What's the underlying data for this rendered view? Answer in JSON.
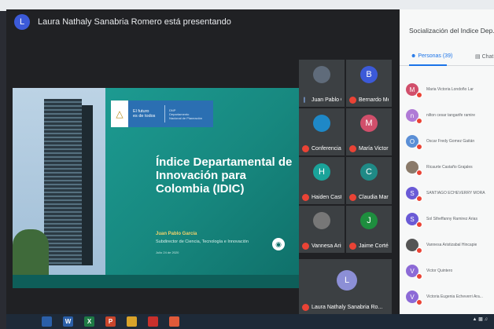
{
  "presenter": {
    "initial": "L",
    "text": "Laura Nathaly Sanabria Romero está presentando"
  },
  "slide": {
    "gov_line1": "El futuro",
    "gov_line2": "es de todos",
    "dnp_line1": "DNP",
    "dnp_line2": "Departamento",
    "dnp_line3": "Nacional de Planeación",
    "title": "Índice Departamental de Innovación para Colombia (IDIC)",
    "speaker": "Juan Pablo García",
    "role": "Subdirector de Ciencia, Tecnología e Innovación",
    "date": "Julio 24 de 2020"
  },
  "tiles": [
    {
      "name": "Juan Pablo G...",
      "initial": "",
      "color": "#5f6b7a",
      "mic_on": true
    },
    {
      "name": "Bernardo Mes...",
      "initial": "B",
      "color": "#3c5ad8",
      "mic_on": false
    },
    {
      "name": "Conferencias ...",
      "initial": "",
      "color": "#1e88c7",
      "mic_on": false
    },
    {
      "name": "María Victoria...",
      "initial": "M",
      "color": "#d14f6b",
      "mic_on": false
    },
    {
      "name": "Haiden Castill...",
      "initial": "H",
      "color": "#1aa39a",
      "mic_on": false
    },
    {
      "name": "Claudia Marc...",
      "initial": "C",
      "color": "#1f8a86",
      "mic_on": false
    },
    {
      "name": "Vannesa Arist...",
      "initial": "",
      "color": "#777777",
      "mic_on": false
    },
    {
      "name": "Jaime Cortés",
      "initial": "J",
      "color": "#1e8e3e",
      "mic_on": false
    }
  ],
  "big_tile": {
    "name": "Laura Nathaly Sanabria Ro...",
    "initial": "L",
    "color": "#8c8fd6"
  },
  "panel": {
    "title": "Socialización del Indice Dep...",
    "tab_people": "Personas (39)",
    "tab_chat": "Chat"
  },
  "people": [
    {
      "initial": "M",
      "color": "#d14f6b",
      "name": "Maria Victoria Londoño Lar"
    },
    {
      "initial": "n",
      "color": "#b07ad6",
      "name": "nilton cesar tangarife ramire"
    },
    {
      "initial": "O",
      "color": "#5b8fd6",
      "name": "Oscar Fredy Gomez Gaitán"
    },
    {
      "initial": "",
      "color": "#8a7a6a",
      "name": "Ricaurte Castaño Grajales"
    },
    {
      "initial": "S",
      "color": "#6a5ad6",
      "name": "SANTIAGO ECHEVERRY MORA"
    },
    {
      "initial": "S",
      "color": "#6a5ad6",
      "name": "Sol Stheffanny Ramirez Arias"
    },
    {
      "initial": "",
      "color": "#555555",
      "name": "Vannesa Aristizabal Hincapie"
    },
    {
      "initial": "V",
      "color": "#8c6ad6",
      "name": "Victor Quintero"
    },
    {
      "initial": "V",
      "color": "#8c6ad6",
      "name": "Victoria Eugenia Echeverri Ara..."
    }
  ],
  "taskbar": {
    "icons": [
      {
        "name": "start-icon",
        "label": "",
        "color": "#1e2a38"
      },
      {
        "name": "edge-icon",
        "label": "",
        "color": "#2b5fa8"
      },
      {
        "name": "word-icon",
        "label": "W",
        "color": "#2b5fa8"
      },
      {
        "name": "excel-icon",
        "label": "X",
        "color": "#1e7a45"
      },
      {
        "name": "powerpoint-icon",
        "label": "P",
        "color": "#c8452c"
      },
      {
        "name": "explorer-icon",
        "label": "",
        "color": "#d9a32a"
      },
      {
        "name": "pdf-icon",
        "label": "",
        "color": "#c8302c"
      },
      {
        "name": "chrome-icon",
        "label": "",
        "color": "#e05a3a"
      }
    ]
  }
}
